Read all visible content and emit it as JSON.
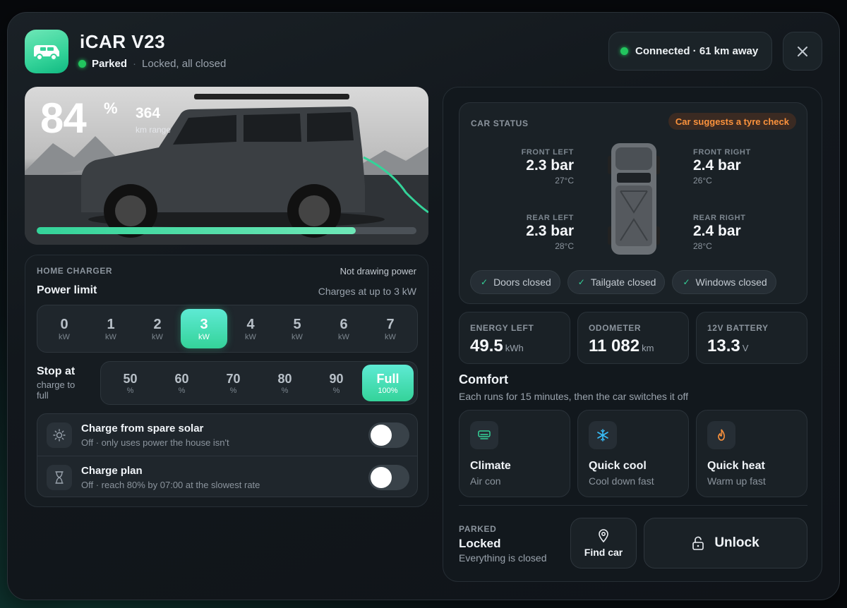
{
  "header": {
    "title": "iCAR V23",
    "status": "Parked",
    "separator": "·",
    "substatus": "Locked, all closed",
    "connection": "Connected · 61 km away"
  },
  "hero": {
    "battery_percent": "84",
    "battery_unit": "%",
    "range_value": "364",
    "range_label": "km range",
    "charge_level": 0.84
  },
  "charger": {
    "caption": "HOME CHARGER",
    "status": "Not drawing power",
    "power_limit_label": "Power limit",
    "power_limit_sub": "Charges at up to 3 kW",
    "kw_options": [
      {
        "value": "0",
        "unit": "kW"
      },
      {
        "value": "1",
        "unit": "kW"
      },
      {
        "value": "2",
        "unit": "kW"
      },
      {
        "value": "3",
        "unit": "kW"
      },
      {
        "value": "4",
        "unit": "kW"
      },
      {
        "value": "5",
        "unit": "kW"
      },
      {
        "value": "6",
        "unit": "kW"
      },
      {
        "value": "7",
        "unit": "kW"
      }
    ],
    "kw_selected": "3",
    "stop_label": "Stop at",
    "stop_sub": "charge to full",
    "stop_options": [
      {
        "value": "50",
        "unit": "%"
      },
      {
        "value": "60",
        "unit": "%"
      },
      {
        "value": "70",
        "unit": "%"
      },
      {
        "value": "80",
        "unit": "%"
      },
      {
        "value": "90",
        "unit": "%"
      },
      {
        "value": "Full",
        "unit": "100%"
      }
    ],
    "stop_selected": "Full",
    "toggles": [
      {
        "title": "Charge from spare solar",
        "sub": "Off · only uses power the house isn't",
        "icon": "sun-icon",
        "on": false
      },
      {
        "title": "Charge plan",
        "sub": "Off · reach 80% by 07:00 at the slowest rate",
        "icon": "hourglass-icon",
        "on": false
      }
    ]
  },
  "car_status": {
    "caption": "CAR STATUS",
    "badge": "Car suggests a tyre check",
    "tyres": {
      "front_left": {
        "label": "FRONT LEFT",
        "pressure": "2.3 bar",
        "temp": "27°C"
      },
      "front_right": {
        "label": "FRONT RIGHT",
        "pressure": "2.4 bar",
        "temp": "26°C"
      },
      "rear_left": {
        "label": "REAR LEFT",
        "pressure": "2.3 bar",
        "temp": "28°C"
      },
      "rear_right": {
        "label": "REAR RIGHT",
        "pressure": "2.4 bar",
        "temp": "28°C"
      }
    },
    "chips": [
      "Doors closed",
      "Tailgate closed",
      "Windows closed"
    ]
  },
  "stats": [
    {
      "label": "ENERGY LEFT",
      "value": "49.5",
      "unit": "kWh"
    },
    {
      "label": "ODOMETER",
      "value": "11 082",
      "unit": "km"
    },
    {
      "label": "12V BATTERY",
      "value": "13.3",
      "unit": "V"
    }
  ],
  "comfort": {
    "title": "Comfort",
    "sub": "Each runs for 15 minutes, then the car switches it off",
    "cards": [
      {
        "title": "Climate",
        "sub": "Air con",
        "icon": "air-con-icon"
      },
      {
        "title": "Quick cool",
        "sub": "Cool down fast",
        "icon": "snowflake-icon"
      },
      {
        "title": "Quick heat",
        "sub": "Warm up fast",
        "icon": "flame-icon"
      }
    ]
  },
  "parked": {
    "caption": "PARKED",
    "title": "Locked",
    "sub": "Everything is closed",
    "find_label": "Find car",
    "unlock_label": "Unlock"
  },
  "colors": {
    "accent": "#34d399",
    "status_dot": "#22c55e",
    "warning": "#fb923c"
  }
}
